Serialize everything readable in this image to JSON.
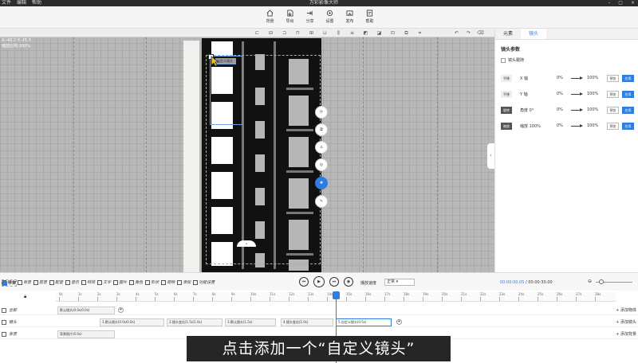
{
  "titlebar": {
    "menu": [
      "文件",
      "编辑",
      "帮助"
    ],
    "title": "万彩影像大师"
  },
  "toolbar": {
    "tools": [
      {
        "label": "背景",
        "icon": "home-icon"
      },
      {
        "label": "导出",
        "icon": "export-icon"
      },
      {
        "label": "分享",
        "icon": "share-icon"
      },
      {
        "label": "设置",
        "icon": "gear-icon"
      },
      {
        "label": "发布",
        "icon": "publish-icon"
      },
      {
        "label": "帮助",
        "icon": "help-icon"
      }
    ]
  },
  "canvas": {
    "coord_line1": "X:-40.2 Y:-25.3",
    "coord_line2": "缩放比例:100%",
    "new_camera_tag": "自定义镜头"
  },
  "panel": {
    "tabs": [
      "元素",
      "镜头"
    ],
    "section_title": "镜头参数",
    "checkbox_label": "镜头跟随",
    "rows": [
      {
        "cat": "平移",
        "name": "X 轴",
        "from": "0%",
        "to": "100%",
        "b1": "预览",
        "b2": "应用"
      },
      {
        "cat": "平移",
        "name": "Y 轴",
        "from": "0%",
        "to": "100%",
        "b1": "预览",
        "b2": "应用"
      },
      {
        "cat": "旋转",
        "name": "角度 0°",
        "from": "0%",
        "to": "100%",
        "b1": "预览",
        "b2": "应用"
      },
      {
        "cat": "缩放",
        "name": "缩放 100%",
        "from": "0%",
        "to": "100%",
        "b1": "预览",
        "b2": "应用"
      }
    ]
  },
  "timeline_toolbar": {
    "tools": [
      "镜头",
      "背景",
      "前景",
      "字幕",
      "配音",
      "音乐",
      "特效",
      "文字",
      "图片",
      "角色",
      "形状",
      "视频",
      "添加",
      "功能设置"
    ],
    "speed_label": "播放速度",
    "speed_value": "正常",
    "time_current": "00:00:00.05",
    "time_total": "00:00:30.00"
  },
  "timeline": {
    "ticks": [
      "0s",
      "1s",
      "2s",
      "3s",
      "4s",
      "5s",
      "6s",
      "7s",
      "8s",
      "9s",
      "10s",
      "11s",
      "12s",
      "13s",
      "14s",
      "15s",
      "16s",
      "17s",
      "18s",
      "19s",
      "20s",
      "21s",
      "22s",
      "23s",
      "24s",
      "25s",
      "26s",
      "27s",
      "28s"
    ],
    "tracks": [
      {
        "label": "全部",
        "add": "+ 添加物体"
      },
      {
        "label": "镜头",
        "add": "+ 添加镜头"
      },
      {
        "label": "背景",
        "add": "+ 添加背景"
      }
    ],
    "track0_clip": "默认镜头(0.0s/0.0s)",
    "camera_clips": [
      "1.默认镜头(0.0s/0.0s)",
      "2.镜头变化(1.5s/1.0s)",
      "3.默认镜头(1.5s)",
      "4.镜头变化(1.0s)",
      "5.自定义镜头(0.5s)"
    ],
    "bg_clip": "背景图片(0.0s)"
  },
  "subtitle": "点击添加一个“自定义镜头”"
}
